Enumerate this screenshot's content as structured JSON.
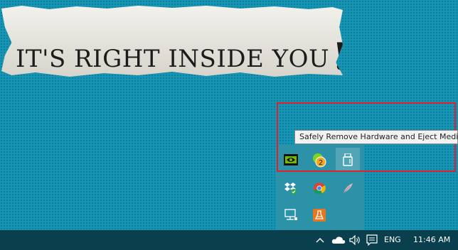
{
  "wallpaper": {
    "headline": "IT'S RIGHT INSIDE YOU",
    "emphasis": "!!"
  },
  "tooltip": {
    "text": "Safely Remove Hardware and Eject Media"
  },
  "tray_overflow": {
    "icons": [
      {
        "name": "nvidia-icon"
      },
      {
        "name": "badge-count-icon",
        "badge": "2"
      },
      {
        "name": "usb-eject-icon"
      },
      {
        "name": "dropbox-icon"
      },
      {
        "name": "chrome-icon"
      },
      {
        "name": "feather-icon"
      },
      {
        "name": "network-computer-icon"
      },
      {
        "name": "app-flask-icon"
      }
    ]
  },
  "taskbar": {
    "language": "ENG",
    "time": "11:46 AM"
  },
  "colors": {
    "desktop": "#1695b4",
    "taskbar": "#0a3f4d",
    "highlight": "#e0202a"
  }
}
